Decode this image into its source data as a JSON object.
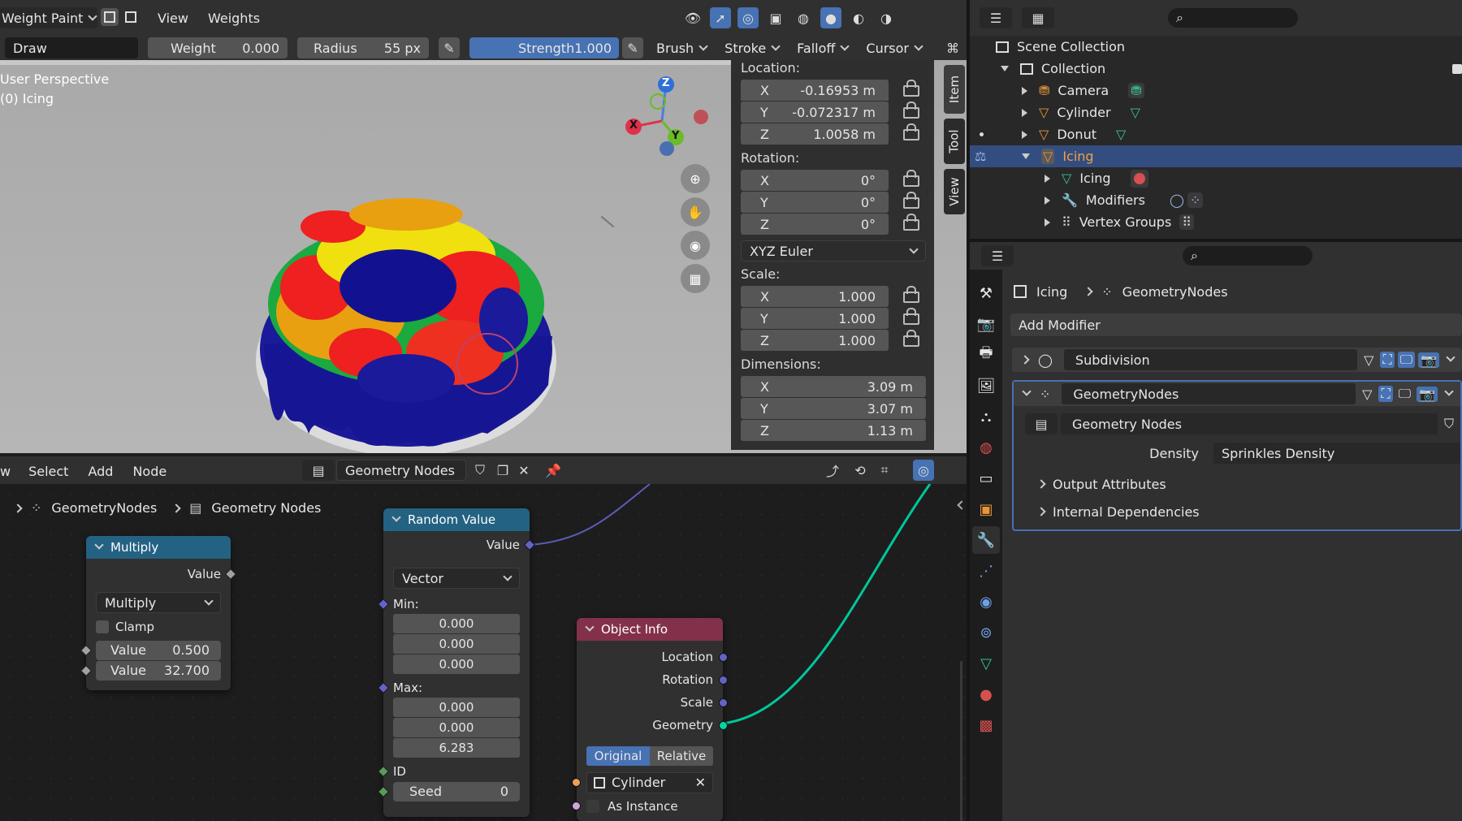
{
  "viewport": {
    "mode": "Weight Paint",
    "menu": [
      "View",
      "Weights"
    ],
    "tool_header": {
      "brush_name": "Draw",
      "weight_label": "Weight",
      "weight_value": "0.000",
      "radius_label": "Radius",
      "radius_value": "55 px",
      "strength_label": "Strength",
      "strength_value": "1.000",
      "menus": [
        "Brush",
        "Stroke",
        "Falloff",
        "Cursor"
      ]
    },
    "overlay_text": {
      "perspective": "User Perspective",
      "object": "(0) Icing"
    },
    "gizmo": {
      "x": "X",
      "y": "Y",
      "z": "Z"
    }
  },
  "npanel": {
    "tabs": [
      "Item",
      "Tool",
      "View"
    ],
    "location_label": "Location:",
    "location": [
      {
        "axis": "X",
        "value": "-0.16953 m"
      },
      {
        "axis": "Y",
        "value": "-0.072317 m"
      },
      {
        "axis": "Z",
        "value": "1.0058 m"
      }
    ],
    "rotation_label": "Rotation:",
    "rotation": [
      {
        "axis": "X",
        "value": "0°"
      },
      {
        "axis": "Y",
        "value": "0°"
      },
      {
        "axis": "Z",
        "value": "0°"
      }
    ],
    "rotation_mode": "XYZ Euler",
    "scale_label": "Scale:",
    "scale": [
      {
        "axis": "X",
        "value": "1.000"
      },
      {
        "axis": "Y",
        "value": "1.000"
      },
      {
        "axis": "Z",
        "value": "1.000"
      }
    ],
    "dimensions_label": "Dimensions:",
    "dimensions": [
      {
        "axis": "X",
        "value": "3.09 m"
      },
      {
        "axis": "Y",
        "value": "3.07 m"
      },
      {
        "axis": "Z",
        "value": "1.13 m"
      }
    ]
  },
  "node_editor": {
    "menu": [
      "w",
      "Select",
      "Add",
      "Node"
    ],
    "tree_name": "Geometry Nodes",
    "breadcrumb": [
      "GeometryNodes",
      "Geometry Nodes"
    ],
    "multiply": {
      "title": "Multiply",
      "output": "Value",
      "operation": "Multiply",
      "clamp_label": "Clamp",
      "value_label": "Value",
      "value1": "0.500",
      "value2": "32.700"
    },
    "random_value": {
      "title": "Random Value",
      "output": "Value",
      "data_type": "Vector",
      "min_label": "Min:",
      "min": [
        "0.000",
        "0.000",
        "0.000"
      ],
      "max_label": "Max:",
      "max": [
        "0.000",
        "0.000",
        "6.283"
      ],
      "id_label": "ID",
      "seed_label": "Seed",
      "seed_value": "0"
    },
    "object_info": {
      "title": "Object Info",
      "outputs": [
        "Location",
        "Rotation",
        "Scale",
        "Geometry"
      ],
      "mode_original": "Original",
      "mode_relative": "Relative",
      "object": "Cylinder",
      "as_instance": "As Instance"
    }
  },
  "outliner": {
    "rows": [
      {
        "label": "Scene Collection"
      },
      {
        "label": "Collection"
      },
      {
        "label": "Camera"
      },
      {
        "label": "Cylinder"
      },
      {
        "label": "Donut"
      },
      {
        "label": "Icing"
      },
      {
        "label": "Icing"
      },
      {
        "label": "Modifiers"
      },
      {
        "label": "Vertex Groups"
      }
    ]
  },
  "properties": {
    "breadcrumb": [
      "Icing",
      "GeometryNodes"
    ],
    "add_modifier": "Add Modifier",
    "modifiers": [
      {
        "name": "Subdivision"
      },
      {
        "name": "GeometryNodes"
      }
    ],
    "node_group": "Geometry Nodes",
    "density_label": "Density",
    "density_value": "Sprinkles Density",
    "panels": [
      "Output Attributes",
      "Internal Dependencies"
    ]
  },
  "colors": {
    "accent": "#4772b3",
    "selection": "#334d80",
    "node_input_header": "#83314a",
    "node_util_header": "#246283",
    "geometry_socket": "#00d6a3",
    "vector_socket": "#6363c7"
  }
}
